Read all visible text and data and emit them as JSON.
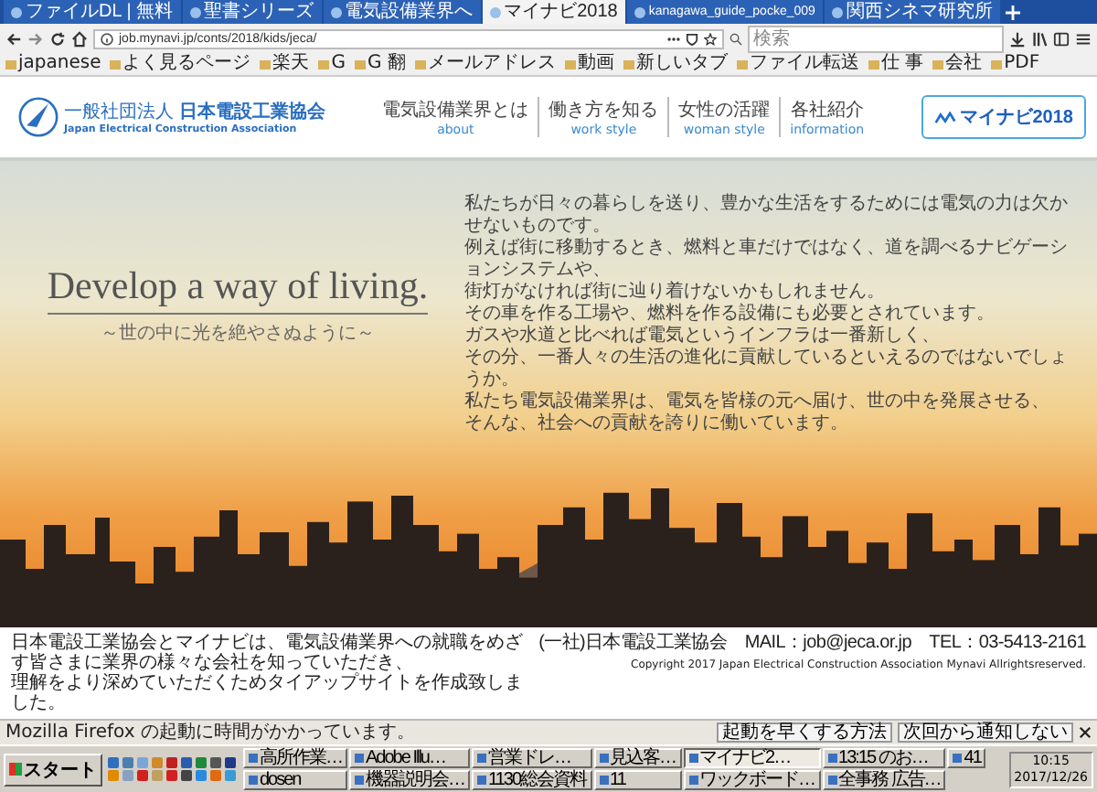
{
  "browser": {
    "tabs": [
      {
        "title": "ファイルDL | 無料",
        "selected": false
      },
      {
        "title": "聖書シリーズ",
        "selected": false
      },
      {
        "title": "電気設備業界へ",
        "selected": false
      },
      {
        "title": "マイナビ2018",
        "selected": true
      },
      {
        "title": "kanagawa_guide_pocke_009",
        "selected": false
      },
      {
        "title": "関西シネマ研究所",
        "selected": false
      }
    ],
    "url": "job.mynavi.jp/conts/2018/kids/jeca/",
    "search": {
      "placeholder": "検索"
    },
    "bookmarks": [
      "japanese",
      "よく見るページ",
      "楽天",
      "G",
      "G 翻",
      "メールアドレス",
      "動画",
      "新しいタブ",
      "ファイル転送",
      "仕 事",
      "会社",
      "PDF"
    ]
  },
  "site_header": {
    "logo": {
      "prefix": "一般社団法人",
      "name": "日本電設工業協会",
      "english": "Japan Electrical Construction Association"
    },
    "nav": [
      {
        "label_ja": "電気設備業界とは",
        "label_en": "about"
      },
      {
        "label_ja": "働き方を知る",
        "label_en": "work style"
      },
      {
        "label_ja": "女性の活躍",
        "label_en": "woman style"
      },
      {
        "label_ja": "各社紹介",
        "label_en": "information"
      }
    ],
    "cta": {
      "label": "マイナビ2018"
    }
  },
  "hero": {
    "headline": "Develop a way of living.",
    "subheadline": "～世の中に光を絶やさぬように～",
    "body_lines": [
      "私たちが日々の暮らしを送り、豊かな生活をするためには電気の力は欠かせないものです。",
      "例えば街に移動するとき、燃料と車だけではなく、道を調べるナビゲーションシステムや、",
      "街灯がなければ街に辿り着けないかもしれません。",
      "その車を作る工場や、燃料を作る設備にも必要とされています。",
      "ガスや水道と比べれば電気というインフラは一番新しく、",
      "その分、一番人々の生活の進化に貢献しているといえるのではないでしょうか。",
      "私たち電気設備業界は、電気を皆様の元へ届け、世の中を発展させる、",
      "そんな、社会への貢献を誇りに働いています。"
    ]
  },
  "footer": {
    "notice_lines": [
      "日本電設工業協会とマイナビは、電気設備業界への就職をめざす皆さまに業界の様々な会社を知っていただき、",
      "理解をより深めていただくためタイアップサイトを作成致しました。"
    ],
    "contact": "(一社)日本電設工業協会　MAIL：job@jeca.or.jp　TEL：03-5413-2161",
    "copyright": "Copyright 2017 Japan Electrical Construction Association Mynavi Allrightsreserved."
  },
  "notification": {
    "message": "Mozilla Firefox の起動に時間がかかっています。",
    "buttons": [
      "起動を早くする方法",
      "次回から通知しない"
    ]
  },
  "taskbar": {
    "start": "スタート",
    "windows": [
      {
        "title": "高所作業…",
        "selected": false
      },
      {
        "title": "Adobe Illu…",
        "selected": false
      },
      {
        "title": "営業ドレ…",
        "selected": false
      },
      {
        "title": "見込客…",
        "selected": false
      },
      {
        "title": "マイナビ2…",
        "selected": true
      },
      {
        "title": "13:15 のお…",
        "selected": false
      },
      {
        "title": "41",
        "selected": false
      },
      {
        "title": "dosen",
        "selected": false
      },
      {
        "title": "機器説明会…",
        "selected": false
      },
      {
        "title": "1130総会資料",
        "selected": false
      },
      {
        "title": "11",
        "selected": false
      },
      {
        "title": "ワックボード…",
        "selected": false
      },
      {
        "title": "全事務 広告…",
        "selected": false
      }
    ],
    "clock": {
      "time": "10:15",
      "date": "2017/12/26"
    }
  }
}
